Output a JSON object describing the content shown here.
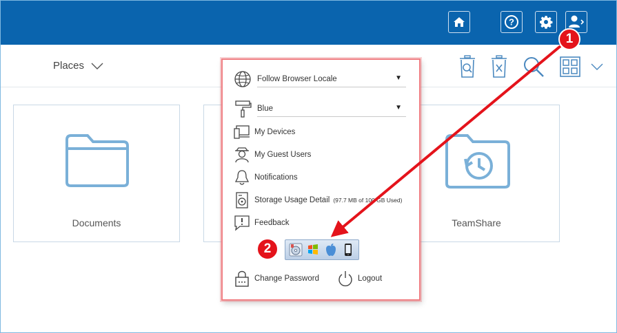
{
  "topbar": {
    "buttons": [
      "home-icon",
      "help-icon",
      "gear-icon",
      "user-menu-icon"
    ]
  },
  "toolbar": {
    "places_label": "Places",
    "tools": [
      "recycle-bin-search-icon",
      "recycle-bin-clear-icon",
      "search-icon",
      "grid-view-icon",
      "chevron-down-icon"
    ]
  },
  "tiles": [
    {
      "label": "Documents",
      "icon": "folder-icon"
    },
    {
      "label": "",
      "icon": ""
    },
    {
      "label": "TeamShare",
      "icon": "folder-history-icon"
    }
  ],
  "menu": {
    "locale_select": {
      "value": "Follow Browser Locale"
    },
    "theme_select": {
      "value": "Blue"
    },
    "items": {
      "devices": "My Devices",
      "guests": "My Guest Users",
      "notifications": "Notifications",
      "storage": "Storage Usage Detail",
      "storage_note": "(97.7 MB of 100 GB Used)",
      "feedback": "Feedback",
      "change_password": "Change Password",
      "logout": "Logout"
    },
    "apps": [
      "disc-installer-icon",
      "windows-icon",
      "apple-icon",
      "mobile-phone-icon"
    ]
  },
  "annotations": {
    "badge_1": "1",
    "badge_2": "2",
    "color": "#e4131b"
  },
  "colors": {
    "topbar": "#0a64ae",
    "accent_icon": "#6aa3cf",
    "panel_border": "#f07f84"
  }
}
